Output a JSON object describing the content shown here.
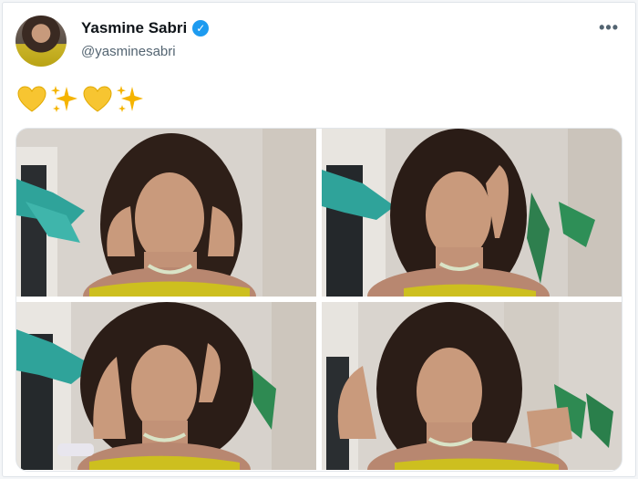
{
  "user": {
    "name": "Yasmine Sabri",
    "handle": "@yasminesabri",
    "verified": true
  },
  "tweet": {
    "emojis": [
      "yellow-heart",
      "sparkles",
      "yellow-heart",
      "sparkles"
    ]
  },
  "media": {
    "count": 4,
    "photos": [
      {
        "name": "photo-1"
      },
      {
        "name": "photo-2"
      },
      {
        "name": "photo-3"
      },
      {
        "name": "photo-4"
      }
    ]
  },
  "icons": {
    "more": "more-options-icon",
    "verified": "verified-badge-icon"
  },
  "colors": {
    "accent": "#1d9bf0",
    "text": "#0f1419",
    "muted": "#536471",
    "heart": "#f7c531",
    "sparkle": "#f5b400",
    "dress": "#cdbf1f",
    "leaf": "#2fa39a"
  }
}
